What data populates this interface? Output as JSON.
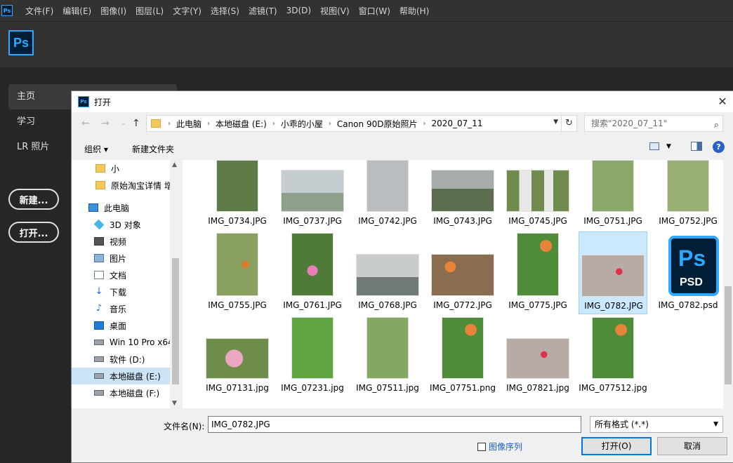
{
  "app": {
    "logo_text": "Ps",
    "menu": [
      "文件(F)",
      "编辑(E)",
      "图像(I)",
      "图层(L)",
      "文字(Y)",
      "选择(S)",
      "滤镜(T)",
      "3D(D)",
      "视图(V)",
      "窗口(W)",
      "帮助(H)"
    ],
    "home_nav": [
      "主页",
      "学习",
      "LR 照片"
    ],
    "new_button": "新建...",
    "open_button": "打开..."
  },
  "dialog": {
    "icon_text": "Ps",
    "title": "打开",
    "breadcrumbs": [
      "此电脑",
      "本地磁盘 (E:)",
      "小乖的小屋",
      "Canon 90D原始照片",
      "2020_07_11"
    ],
    "search_placeholder": "搜索\"2020_07_11\"",
    "organize_label": "组织 ▾",
    "new_folder_label": "新建文件夹",
    "tree": [
      {
        "label": "小",
        "icon": "folder-icon"
      },
      {
        "label": "原始淘宝详情 增",
        "icon": "folder-icon"
      },
      {
        "label": "此电脑",
        "icon": "pc-icon"
      },
      {
        "label": "3D 对象",
        "icon": "cube-icon"
      },
      {
        "label": "视频",
        "icon": "video-icon"
      },
      {
        "label": "图片",
        "icon": "pictures-icon"
      },
      {
        "label": "文档",
        "icon": "documents-icon"
      },
      {
        "label": "下载",
        "icon": "download-icon"
      },
      {
        "label": "音乐",
        "icon": "music-icon"
      },
      {
        "label": "桌面",
        "icon": "desktop-icon"
      },
      {
        "label": "Win 10 Pro x64",
        "icon": "drive-icon"
      },
      {
        "label": "软件 (D:)",
        "icon": "drive-icon"
      },
      {
        "label": "本地磁盘 (E:)",
        "icon": "drive-icon"
      },
      {
        "label": "本地磁盘 (F:)",
        "icon": "drive-icon"
      }
    ],
    "files": [
      {
        "name": "IMG_0734.JPG",
        "color": "#5e7a45"
      },
      {
        "name": "IMG_0737.JPG",
        "color": "#a8b4b6"
      },
      {
        "name": "IMG_0742.JPG",
        "color": "#b9bdbf"
      },
      {
        "name": "IMG_0743.JPG",
        "color": "#7f8c80"
      },
      {
        "name": "IMG_0745.JPG",
        "color": "#6f8b4e"
      },
      {
        "name": "IMG_0751.JPG",
        "color": "#8aa868"
      },
      {
        "name": "IMG_0752.JPG",
        "color": "#97b071"
      },
      {
        "name": "IMG_0755.JPG",
        "color": "#8aa05f"
      },
      {
        "name": "IMG_0761.JPG",
        "color": "#4f7a38"
      },
      {
        "name": "IMG_0768.JPG",
        "color": "#9aa3a6"
      },
      {
        "name": "IMG_0772.JPG",
        "color": "#8a6d4f"
      },
      {
        "name": "IMG_0775.JPG",
        "color": "#4f8c3a"
      },
      {
        "name": "IMG_0782.JPG",
        "color": "#b8aaa5"
      },
      {
        "name": "IMG_0782.psd",
        "color": "#001e36"
      },
      {
        "name": "IMG_07131.jpg",
        "color": "#6e8c4a"
      },
      {
        "name": "IMG_07231.jpg",
        "color": "#5ea43f"
      },
      {
        "name": "IMG_07511.jpg",
        "color": "#84a862"
      },
      {
        "name": "IMG_07751.png",
        "color": "#4f8c3a"
      },
      {
        "name": "IMG_07821.jpg",
        "color": "#b8aaa5"
      },
      {
        "name": "IMG_077512.jpg",
        "color": "#4f8c3a"
      }
    ],
    "psd_label_ps": "Ps",
    "psd_label_psd": "PSD",
    "filename_label": "文件名(N):",
    "filename_value": "IMG_0782.JPG",
    "filter_value": "所有格式 (*.*)",
    "image_sequence_label": "图像序列",
    "open_label": "打开(O)",
    "cancel_label": "取消"
  }
}
